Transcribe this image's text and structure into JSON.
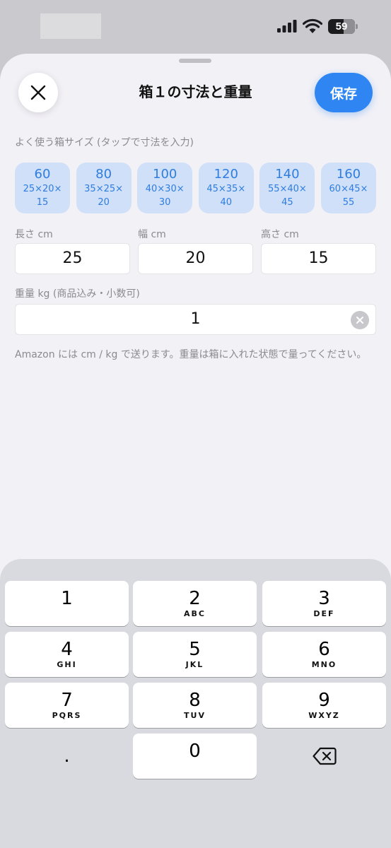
{
  "status": {
    "battery": "59"
  },
  "sheet": {
    "title": "箱１の寸法と重量",
    "save_label": "保存",
    "presets_label": "よく使う箱サイズ (タップで寸法を入力)",
    "presets": [
      {
        "size": "60",
        "dims_line1": "25×20×",
        "dims_line2": "15"
      },
      {
        "size": "80",
        "dims_line1": "35×25×",
        "dims_line2": "20"
      },
      {
        "size": "100",
        "dims_line1": "40×30×",
        "dims_line2": "30"
      },
      {
        "size": "120",
        "dims_line1": "45×35×",
        "dims_line2": "40"
      },
      {
        "size": "140",
        "dims_line1": "55×40×",
        "dims_line2": "45"
      },
      {
        "size": "160",
        "dims_line1": "60×45×",
        "dims_line2": "55"
      }
    ],
    "length": {
      "label": "長さ cm",
      "value": "25"
    },
    "width": {
      "label": "幅 cm",
      "value": "20"
    },
    "height": {
      "label": "高さ cm",
      "value": "15"
    },
    "weight": {
      "label": "重量 kg (商品込み・小数可)",
      "value": "1"
    },
    "note": "Amazon には cm / kg で送ります。重量は箱に入れた状態で量ってください。"
  },
  "keyboard": {
    "keys": [
      {
        "num": "1",
        "letters": ""
      },
      {
        "num": "2",
        "letters": "ABC"
      },
      {
        "num": "3",
        "letters": "DEF"
      },
      {
        "num": "4",
        "letters": "GHI"
      },
      {
        "num": "5",
        "letters": "JKL"
      },
      {
        "num": "6",
        "letters": "MNO"
      },
      {
        "num": "7",
        "letters": "PQRS"
      },
      {
        "num": "8",
        "letters": "TUV"
      },
      {
        "num": "9",
        "letters": "WXYZ"
      },
      {
        "num": "0",
        "letters": ""
      }
    ],
    "dot": "."
  },
  "icons": {
    "close": "close-icon",
    "clear": "clear-icon",
    "backspace": "backspace-icon",
    "signal": "signal-icon",
    "wifi": "wifi-icon"
  },
  "colors": {
    "accent": "#2f86f2",
    "preset_bg": "#cfe0f8",
    "preset_text": "#2f7de0"
  }
}
